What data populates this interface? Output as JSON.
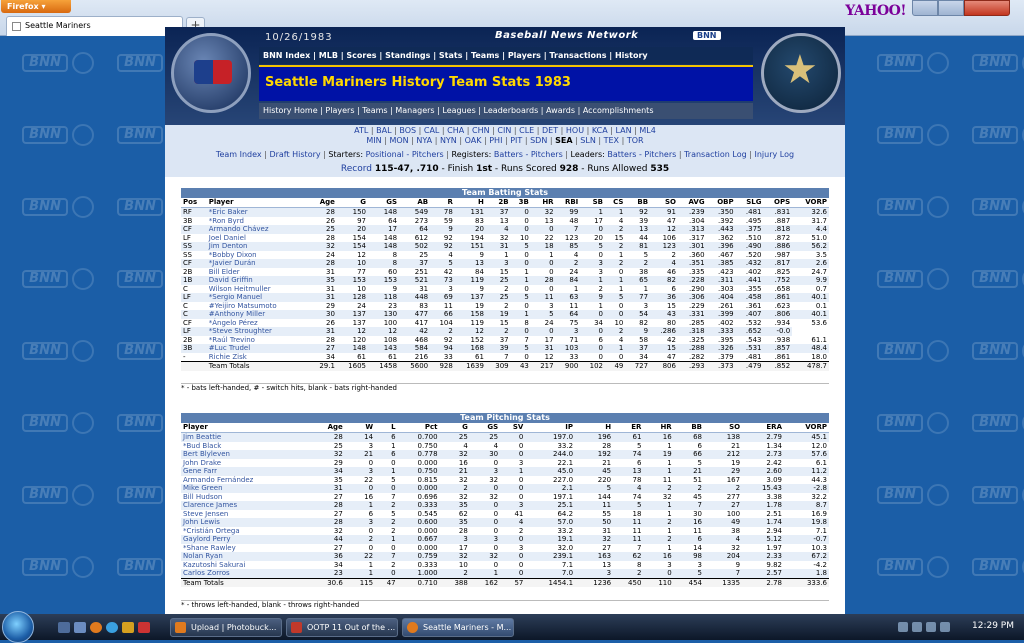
{
  "browser": {
    "app_button": "Firefox",
    "tab_title": "Seattle Mariners",
    "new_tab_label": "+",
    "yahoo": "YAHOO!"
  },
  "header": {
    "date": "10/26/1983",
    "network": "Baseball News Network",
    "bnn_small": "BNN",
    "top_nav": [
      "BNN Index",
      "MLB",
      "Scores",
      "Standings",
      "Stats",
      "Teams",
      "Players",
      "Transactions",
      "History"
    ],
    "title": "Seattle Mariners History Team Stats 1983",
    "sub_nav": [
      "History Home",
      "Players",
      "Teams",
      "Managers",
      "Leagues",
      "Leaderboards",
      "Awards",
      "Accomplishments"
    ]
  },
  "links": {
    "al_teams": [
      "ATL",
      "BAL",
      "BOS",
      "CAL",
      "CHA",
      "CHN",
      "CIN",
      "CLE",
      "DET",
      "HOU",
      "KCA",
      "LAN",
      "ML4"
    ],
    "nl_teams": [
      "MIN",
      "MON",
      "NYA",
      "NYN",
      "OAK",
      "PHI",
      "PIT",
      "SDN",
      "SEA",
      "SLN",
      "TEX",
      "TOR"
    ],
    "selected_team": "SEA",
    "row3": {
      "team_index": "Team Index",
      "draft_history": "Draft History",
      "starters": "Starters:",
      "positional": "Positional",
      "pitchers": "Pitchers",
      "registers": "Registers:",
      "batters": "Batters",
      "pitchers2": "Pitchers",
      "leaders": "Leaders:",
      "batters2": "Batters",
      "pitchers3": "Pitchers",
      "transaction_log": "Transaction Log",
      "injury_log": "Injury Log"
    },
    "record": {
      "label": "Record",
      "value": "115-47, .710",
      "finish_label": " - Finish ",
      "finish": "1st",
      "runs_scored_label": " - Runs Scored ",
      "runs_scored": "928",
      "runs_allowed_label": " - Runs Allowed ",
      "runs_allowed": "535"
    }
  },
  "batting": {
    "title": "Team Batting Stats",
    "columns": [
      "Pos",
      "Player",
      "Age",
      "G",
      "GS",
      "AB",
      "R",
      "H",
      "2B",
      "3B",
      "HR",
      "RBI",
      "SB",
      "CS",
      "BB",
      "SO",
      "AVG",
      "OBP",
      "SLG",
      "OPS",
      "VORP"
    ],
    "rows": [
      [
        "RF",
        "*Eric Baker",
        "28",
        "150",
        "148",
        "549",
        "78",
        "131",
        "37",
        "0",
        "32",
        "99",
        "1",
        "1",
        "92",
        "91",
        ".239",
        ".350",
        ".481",
        ".831",
        "32.6"
      ],
      [
        "3B",
        "*Ron Byrd",
        "26",
        "97",
        "64",
        "273",
        "59",
        "83",
        "13",
        "0",
        "13",
        "48",
        "17",
        "4",
        "39",
        "47",
        ".304",
        ".392",
        ".495",
        ".887",
        "31.7"
      ],
      [
        "CF",
        "Armando Chávez",
        "25",
        "20",
        "17",
        "64",
        "9",
        "20",
        "4",
        "0",
        "0",
        "7",
        "0",
        "2",
        "13",
        "12",
        ".313",
        ".443",
        ".375",
        ".818",
        "4.4"
      ],
      [
        "LF",
        "Joel Daniel",
        "28",
        "154",
        "148",
        "612",
        "92",
        "194",
        "32",
        "10",
        "22",
        "123",
        "20",
        "15",
        "44",
        "106",
        ".317",
        ".362",
        ".510",
        ".872",
        "51.0"
      ],
      [
        "SS",
        "Jim Denton",
        "32",
        "154",
        "148",
        "502",
        "92",
        "151",
        "31",
        "5",
        "18",
        "85",
        "5",
        "2",
        "81",
        "123",
        ".301",
        ".396",
        ".490",
        ".886",
        "56.2"
      ],
      [
        "SS",
        "*Bobby Dixon",
        "24",
        "12",
        "8",
        "25",
        "4",
        "9",
        "1",
        "0",
        "1",
        "4",
        "0",
        "1",
        "5",
        "2",
        ".360",
        ".467",
        ".520",
        ".987",
        "3.5"
      ],
      [
        "CF",
        "*Javier Durán",
        "28",
        "10",
        "8",
        "37",
        "5",
        "13",
        "3",
        "0",
        "0",
        "2",
        "3",
        "2",
        "2",
        "4",
        ".351",
        ".385",
        ".432",
        ".817",
        "2.6"
      ],
      [
        "2B",
        "Bill Elder",
        "31",
        "77",
        "60",
        "251",
        "42",
        "84",
        "15",
        "1",
        "0",
        "24",
        "3",
        "0",
        "38",
        "46",
        ".335",
        ".423",
        ".402",
        ".825",
        "24.7"
      ],
      [
        "1B",
        "David Griffin",
        "35",
        "153",
        "153",
        "521",
        "73",
        "119",
        "25",
        "1",
        "28",
        "84",
        "1",
        "1",
        "65",
        "82",
        ".228",
        ".311",
        ".441",
        ".752",
        "9.9"
      ],
      [
        "C",
        "Wilson Heitmuller",
        "31",
        "10",
        "9",
        "31",
        "3",
        "9",
        "2",
        "0",
        "0",
        "1",
        "2",
        "1",
        "1",
        "6",
        ".290",
        ".303",
        ".355",
        ".658",
        "0.7"
      ],
      [
        "LF",
        "*Sergio Manuel",
        "31",
        "128",
        "118",
        "448",
        "69",
        "137",
        "25",
        "5",
        "11",
        "63",
        "9",
        "5",
        "77",
        "36",
        ".306",
        ".404",
        ".458",
        ".861",
        "40.1"
      ],
      [
        "C",
        "#Yeijiro Matsumoto",
        "29",
        "24",
        "23",
        "83",
        "11",
        "19",
        "2",
        "0",
        "3",
        "11",
        "1",
        "0",
        "3",
        "15",
        ".229",
        ".261",
        ".361",
        ".623",
        "0.1"
      ],
      [
        "C",
        "#Anthony Miller",
        "30",
        "137",
        "130",
        "477",
        "66",
        "158",
        "19",
        "1",
        "5",
        "64",
        "0",
        "0",
        "54",
        "43",
        ".331",
        ".399",
        ".407",
        ".806",
        "40.1"
      ],
      [
        "CF",
        "*Ángelo Pérez",
        "26",
        "137",
        "100",
        "417",
        "104",
        "119",
        "15",
        "8",
        "24",
        "75",
        "34",
        "10",
        "82",
        "80",
        ".285",
        ".402",
        ".532",
        ".934",
        "53.6"
      ],
      [
        "LF",
        "*Steve Stroughter",
        "31",
        "12",
        "12",
        "42",
        "2",
        "12",
        "2",
        "0",
        "0",
        "3",
        "0",
        "2",
        "9",
        ".286",
        ".318",
        ".333",
        ".652",
        "-0.0"
      ],
      [
        "2B",
        "*Raúl Trevino",
        "28",
        "120",
        "108",
        "468",
        "92",
        "152",
        "37",
        "7",
        "17",
        "71",
        "6",
        "4",
        "58",
        "42",
        ".325",
        ".395",
        ".543",
        ".938",
        "61.1"
      ],
      [
        "3B",
        "#Luc Trudel",
        "27",
        "148",
        "143",
        "584",
        "94",
        "168",
        "39",
        "5",
        "31",
        "103",
        "0",
        "1",
        "37",
        "15",
        ".288",
        ".326",
        ".531",
        ".857",
        "48.4"
      ],
      [
        "-",
        "Richie Zisk",
        "34",
        "61",
        "61",
        "216",
        "33",
        "61",
        "7",
        "0",
        "12",
        "33",
        "0",
        "0",
        "34",
        "47",
        ".282",
        ".379",
        ".481",
        ".861",
        "18.0"
      ]
    ],
    "total": [
      "",
      "Team Totals",
      "29.1",
      "1605",
      "1458",
      "5600",
      "928",
      "1639",
      "309",
      "43",
      "217",
      "900",
      "102",
      "49",
      "727",
      "806",
      ".293",
      ".373",
      ".479",
      ".852",
      "478.7"
    ],
    "note": "* - bats left-handed, # - switch hits, blank - bats right-handed"
  },
  "pitching": {
    "title": "Team Pitching Stats",
    "columns": [
      "Player",
      "Age",
      "W",
      "L",
      "Pct",
      "G",
      "GS",
      "SV",
      "IP",
      "H",
      "ER",
      "HR",
      "BB",
      "SO",
      "ERA",
      "VORP"
    ],
    "rows": [
      [
        "Jim Beattie",
        "28",
        "14",
        "6",
        "0.700",
        "25",
        "25",
        "0",
        "197.0",
        "196",
        "61",
        "16",
        "68",
        "138",
        "2.79",
        "45.1"
      ],
      [
        "*Bud Black",
        "25",
        "3",
        "1",
        "0.750",
        "4",
        "4",
        "0",
        "33.2",
        "28",
        "5",
        "1",
        "6",
        "21",
        "1.34",
        "12.0"
      ],
      [
        "Bert Blyleven",
        "32",
        "21",
        "6",
        "0.778",
        "32",
        "30",
        "0",
        "244.0",
        "192",
        "74",
        "19",
        "66",
        "212",
        "2.73",
        "57.6"
      ],
      [
        "John Drake",
        "29",
        "0",
        "0",
        "0.000",
        "16",
        "0",
        "3",
        "22.1",
        "21",
        "6",
        "1",
        "5",
        "19",
        "2.42",
        "6.1"
      ],
      [
        "Gene Farr",
        "34",
        "3",
        "1",
        "0.750",
        "21",
        "3",
        "1",
        "45.0",
        "45",
        "13",
        "1",
        "21",
        "29",
        "2.60",
        "11.2"
      ],
      [
        "Armando Fernández",
        "35",
        "22",
        "5",
        "0.815",
        "32",
        "32",
        "0",
        "227.0",
        "220",
        "78",
        "11",
        "51",
        "167",
        "3.09",
        "44.3"
      ],
      [
        "Mike Green",
        "31",
        "0",
        "0",
        "0.000",
        "2",
        "0",
        "0",
        "2.1",
        "5",
        "4",
        "2",
        "2",
        "2",
        "15.43",
        "-2.8"
      ],
      [
        "Bill Hudson",
        "27",
        "16",
        "7",
        "0.696",
        "32",
        "32",
        "0",
        "197.1",
        "144",
        "74",
        "32",
        "45",
        "277",
        "3.38",
        "32.2"
      ],
      [
        "Clarence James",
        "28",
        "1",
        "2",
        "0.333",
        "35",
        "0",
        "3",
        "25.1",
        "11",
        "5",
        "1",
        "7",
        "27",
        "1.78",
        "8.7"
      ],
      [
        "Steve Jensen",
        "27",
        "6",
        "5",
        "0.545",
        "62",
        "0",
        "41",
        "64.2",
        "55",
        "18",
        "1",
        "30",
        "100",
        "2.51",
        "16.9"
      ],
      [
        "John Lewis",
        "28",
        "3",
        "2",
        "0.600",
        "35",
        "0",
        "4",
        "57.0",
        "50",
        "11",
        "2",
        "16",
        "49",
        "1.74",
        "19.8"
      ],
      [
        "*Cristián Ortega",
        "32",
        "0",
        "2",
        "0.000",
        "28",
        "0",
        "2",
        "33.2",
        "31",
        "11",
        "1",
        "11",
        "38",
        "2.94",
        "7.1"
      ],
      [
        "Gaylord Perry",
        "44",
        "2",
        "1",
        "0.667",
        "3",
        "3",
        "0",
        "19.1",
        "32",
        "11",
        "2",
        "6",
        "4",
        "5.12",
        "-0.7"
      ],
      [
        "*Shane Rawley",
        "27",
        "0",
        "0",
        "0.000",
        "17",
        "0",
        "3",
        "32.0",
        "27",
        "7",
        "1",
        "14",
        "32",
        "1.97",
        "10.3"
      ],
      [
        "Nolan Ryan",
        "36",
        "22",
        "7",
        "0.759",
        "32",
        "32",
        "0",
        "239.1",
        "163",
        "62",
        "16",
        "98",
        "204",
        "2.33",
        "67.2"
      ],
      [
        "Kazutoshi Sakurai",
        "34",
        "1",
        "2",
        "0.333",
        "10",
        "0",
        "0",
        "7.1",
        "13",
        "8",
        "3",
        "3",
        "9",
        "9.82",
        "-4.2"
      ],
      [
        "Carlos Zorros",
        "23",
        "1",
        "0",
        "1.000",
        "2",
        "1",
        "0",
        "7.0",
        "3",
        "2",
        "0",
        "5",
        "7",
        "2.57",
        "1.8"
      ]
    ],
    "total": [
      "Team Totals",
      "30.6",
      "115",
      "47",
      "0.710",
      "388",
      "162",
      "57",
      "1454.1",
      "1236",
      "450",
      "110",
      "454",
      "1335",
      "2.78",
      "333.6"
    ],
    "note": "* - throws left-handed, blank - throws right-handed"
  },
  "taskbar": {
    "buttons": [
      "Upload | Photobuck...",
      "OOTP 11 Out of the ...",
      "Seattle Mariners - M..."
    ],
    "clock": "12:29 PM"
  },
  "colors": {
    "accent": "#5b7fb0",
    "title_yellow": "#ffd800",
    "title_bg": "#0012a6",
    "link": "#1f3f9f"
  }
}
